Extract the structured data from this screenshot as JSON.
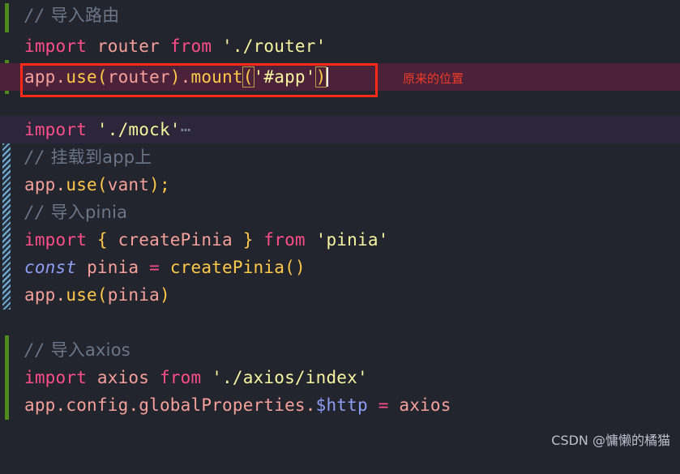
{
  "editor": {
    "background": "#22242e",
    "selected_line_background": "#4b2239",
    "folded_line_background": "#2b2639",
    "change_bar_color": "#4e8a1e",
    "fold_stripe_color": "#6fb4d8",
    "lines": [
      {
        "id": "line-comment-import-router",
        "text": "// 导入路由"
      },
      {
        "id": "line-import-router",
        "text": "import router from './router'"
      },
      {
        "id": "line-app-use-router-mount",
        "text": "app.use(router).mount('#app')"
      },
      {
        "id": "line-blank-1",
        "text": ""
      },
      {
        "id": "line-import-mock",
        "text": "import './mock'⋯"
      },
      {
        "id": "line-comment-mount-to-app",
        "text": "// 挂载到app上"
      },
      {
        "id": "line-app-use-vant",
        "text": "app.use(vant);"
      },
      {
        "id": "line-comment-import-pinia",
        "text": "// 导入pinia"
      },
      {
        "id": "line-import-create-pinia",
        "text": "import { createPinia } from 'pinia'"
      },
      {
        "id": "line-const-pinia",
        "text": "const pinia = createPinia()"
      },
      {
        "id": "line-app-use-pinia",
        "text": "app.use(pinia)"
      },
      {
        "id": "line-blank-2",
        "text": ""
      },
      {
        "id": "line-comment-import-axios",
        "text": "// 导入axios"
      },
      {
        "id": "line-import-axios",
        "text": "import axios from './axios/index'"
      },
      {
        "id": "line-app-config-http",
        "text": "app.config.globalProperties.$http = axios"
      }
    ],
    "tokens": {
      "comment_slashes": "//",
      "comment_import_router_cjk": " 导入路由",
      "comment_mount_to_app_cjk": " 挂载到app上",
      "comment_import_pinia_cjk": " 导入pinia",
      "comment_import_axios_cjk": " 导入axios",
      "kw_import": "import",
      "kw_from": "from",
      "kw_const": "const",
      "id_router": "router",
      "id_axios": "axios",
      "id_app": "app",
      "id_vant": "vant",
      "id_pinia": "pinia",
      "id_create_pinia": "createPinia",
      "id_use": "use",
      "id_mount": "mount",
      "id_config": "config",
      "id_global_properties": "globalProperties",
      "prop_http": "$http",
      "str_router": "'./router'",
      "str_mock": "'./mock'",
      "str_pinia": "'pinia'",
      "str_axios_index": "'./axios/index'",
      "str_app_selector": "'#app'",
      "op_equals": "=",
      "punc_dot": ".",
      "punc_semicolon": ";",
      "punc_open_paren": "(",
      "punc_close_paren": ")",
      "punc_open_brace": "{",
      "punc_close_brace": "}",
      "fold_ellipsis": "⋯",
      "fold_chevron": "›"
    }
  },
  "annotation": {
    "label": "原来的位置",
    "box_color": "#ff2a16",
    "label_color": "#f03a26"
  },
  "watermark": {
    "text": "CSDN @慵懒的橘猫"
  }
}
